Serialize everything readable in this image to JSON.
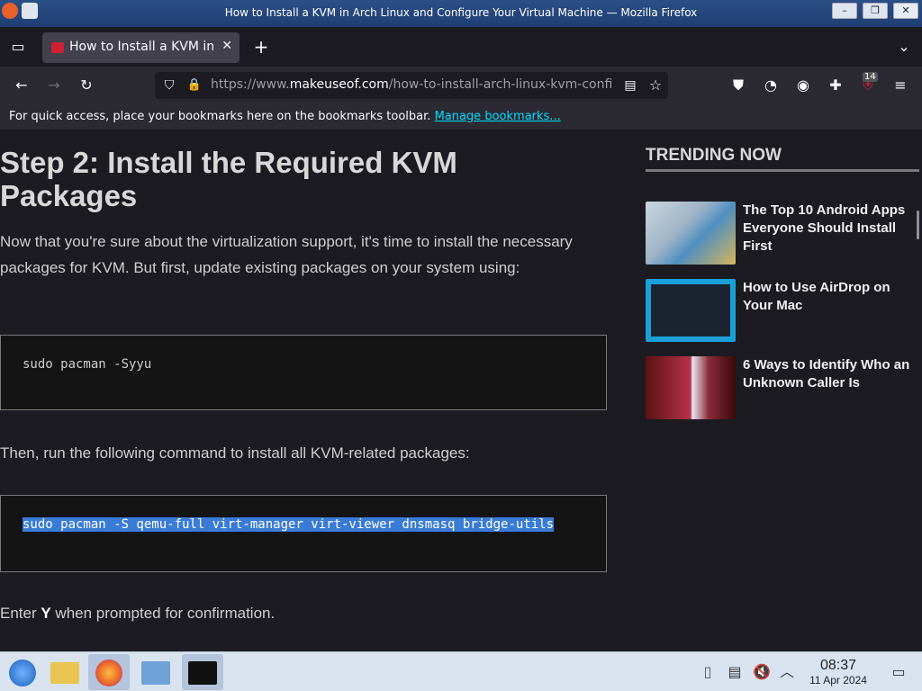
{
  "window": {
    "title": "How to Install a KVM in Arch Linux and Configure Your Virtual Machine — Mozilla Firefox",
    "controls": [
      "–",
      "❐",
      "✕"
    ]
  },
  "tabs": [
    {
      "title": "How to Install a KVM in A",
      "close": "✕"
    }
  ],
  "new_tab": "+",
  "urlbar": {
    "prefix": "https://www.",
    "domain": "makeuseof.com",
    "path": "/how-to-install-arch-linux-kvm-confi"
  },
  "toolbar": {
    "back": "←",
    "forward": "→",
    "reload": "↻",
    "extension_badge": "14"
  },
  "bookmarks_bar": {
    "message": "For quick access, place your bookmarks here on the bookmarks toolbar.",
    "link": "Manage bookmarks..."
  },
  "article": {
    "heading": "Step 2: Install the Required KVM Packages",
    "para1": "Now that you're sure about the virtualization support, it's time to install the necessary packages for KVM. But first, update existing packages on your system using:",
    "code1": "sudo pacman -Syyu",
    "para2": "Then, run the following command to install all KVM-related packages:",
    "code2": "sudo pacman -S qemu-full virt-manager virt-viewer dnsmasq bridge-utils",
    "para3_prefix": "Enter ",
    "para3_bold": "Y",
    "para3_suffix": " when prompted for confirmation."
  },
  "sidebar": {
    "heading": "TRENDING NOW",
    "items": [
      {
        "title": "The Top 10 Android Apps Everyone Should Install First"
      },
      {
        "title": "How to Use AirDrop on Your Mac"
      },
      {
        "title": "6 Ways to Identify Who an Unknown Caller Is"
      }
    ]
  },
  "taskbar": {
    "time": "08:37",
    "date": "11 Apr 2024"
  }
}
